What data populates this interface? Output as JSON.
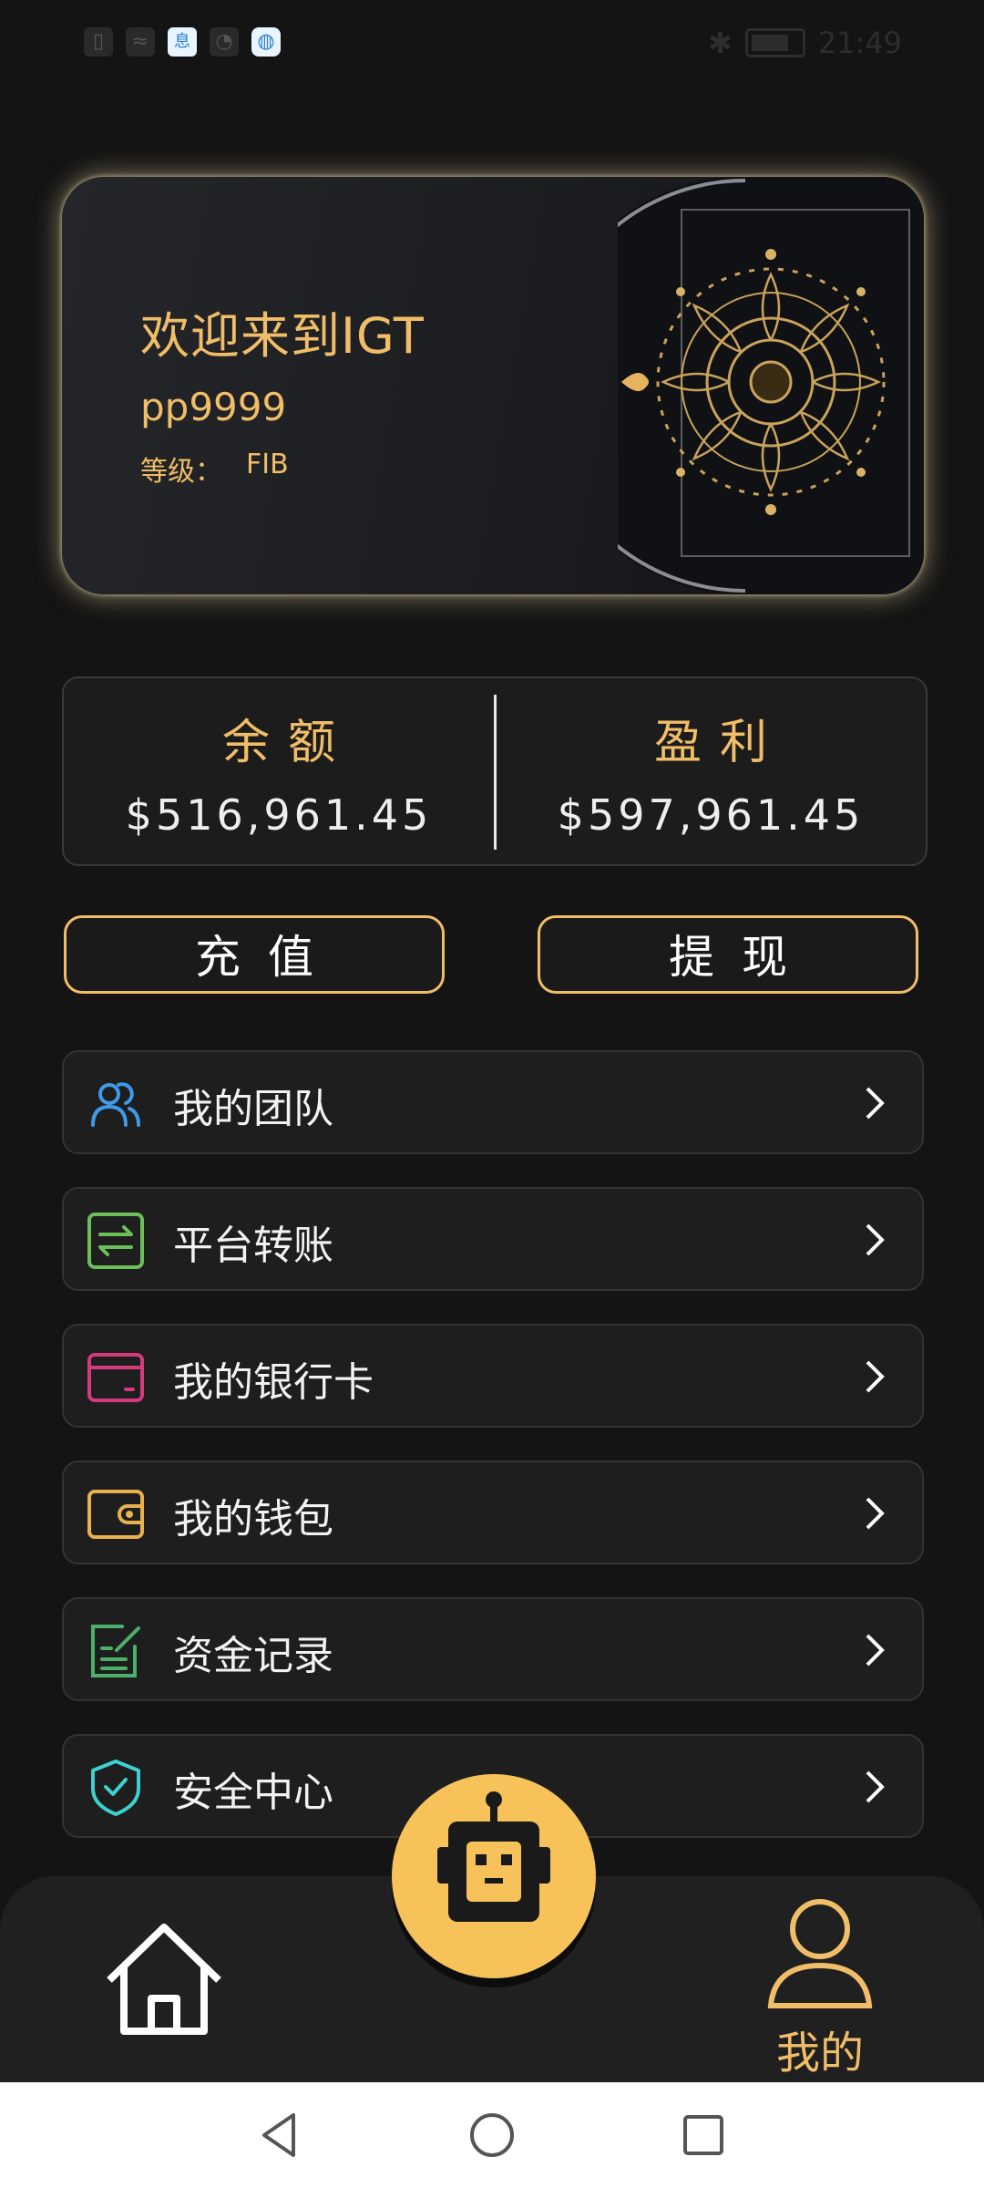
{
  "status_bar": {
    "time": "21:49"
  },
  "card": {
    "title": "欢迎来到IGT",
    "username": "pp9999",
    "level_label": "等级：",
    "level_value": "FIB"
  },
  "balance": {
    "label": "余额",
    "value": "$516,961.45"
  },
  "profit": {
    "label": "盈利",
    "value": "$597,961.45"
  },
  "actions": {
    "recharge": "充值",
    "withdraw": "提现"
  },
  "menu": [
    {
      "label": "我的团队",
      "icon": "team-icon",
      "color": "#3d9be9"
    },
    {
      "label": "平台转账",
      "icon": "transfer-icon",
      "color": "#6bbf59"
    },
    {
      "label": "我的银行卡",
      "icon": "bank-card-icon",
      "color": "#d43a7e"
    },
    {
      "label": "我的钱包",
      "icon": "wallet-icon",
      "color": "#e8b04f"
    },
    {
      "label": "资金记录",
      "icon": "fund-record-icon",
      "color": "#4caf6a"
    },
    {
      "label": "安全中心",
      "icon": "security-shield-icon",
      "color": "#3fd0d0"
    }
  ],
  "bottom_nav": {
    "me_label": "我的"
  },
  "colors": {
    "accent": "#f0bd68",
    "background": "#141414"
  }
}
